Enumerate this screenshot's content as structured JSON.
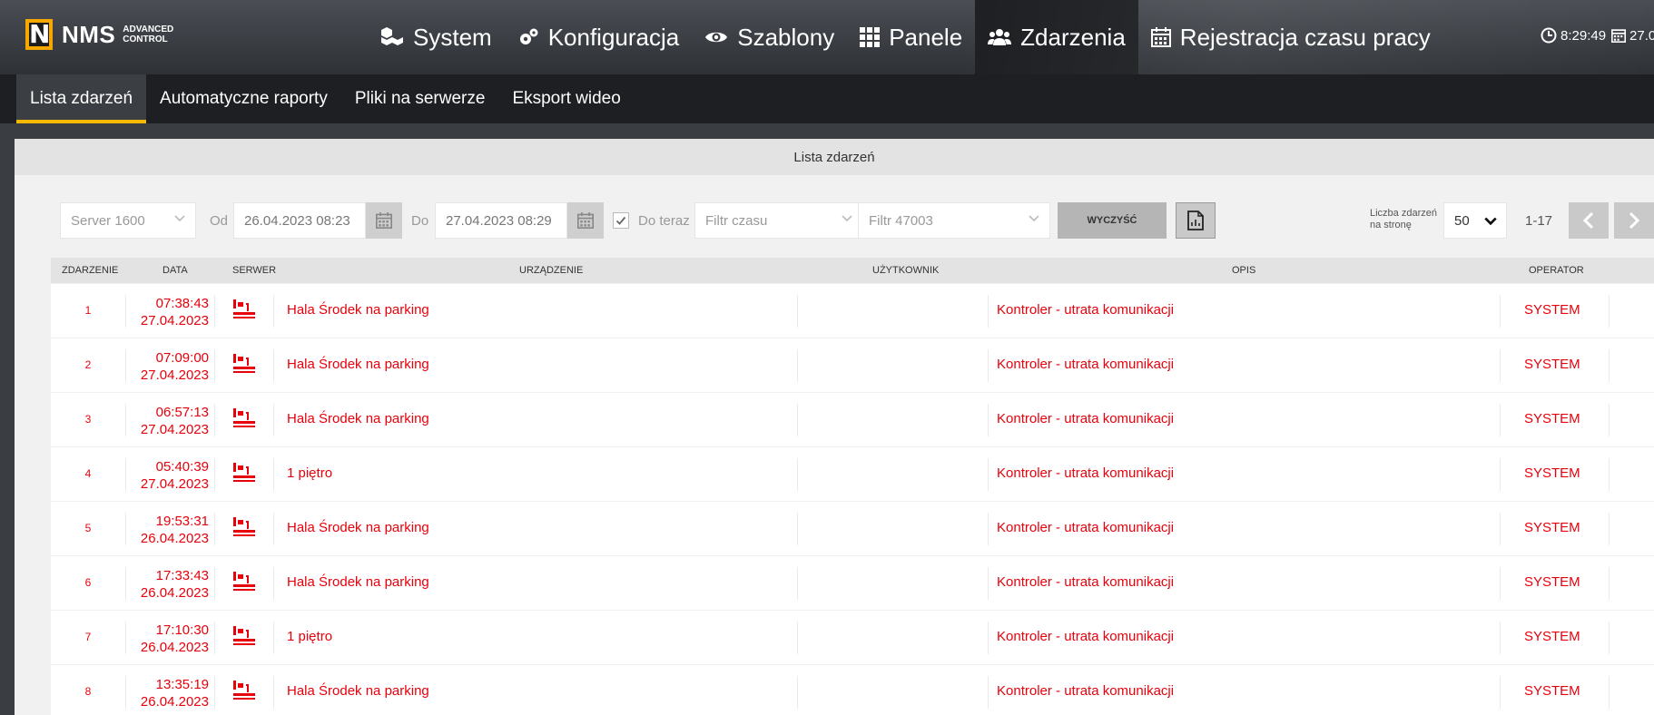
{
  "app": {
    "logo_text": "NMS",
    "logo_sub_1": "ADVANCED",
    "logo_sub_2": "CONTROL"
  },
  "mainnav": [
    {
      "label": "System",
      "icon": "cubes-icon"
    },
    {
      "label": "Konfiguracja",
      "icon": "gears-icon"
    },
    {
      "label": "Szablony",
      "icon": "eye-icon"
    },
    {
      "label": "Panele",
      "icon": "grid-icon"
    },
    {
      "label": "Zdarzenia",
      "icon": "users-icon",
      "active": true
    },
    {
      "label": "Rejestracja czasu pracy",
      "icon": "calendar-icon"
    }
  ],
  "clock": {
    "time": "8:29:49",
    "date": "27.0"
  },
  "subnav": [
    {
      "label": "Lista zdarzeń",
      "active": true
    },
    {
      "label": "Automatyczne raporty"
    },
    {
      "label": "Pliki na serwerze"
    },
    {
      "label": "Eksport wideo"
    }
  ],
  "panel": {
    "title": "Lista zdarzeń"
  },
  "filters": {
    "server": "Server 1600",
    "from_label": "Od",
    "from_value": "26.04.2023 08:23",
    "to_label": "Do",
    "to_value": "27.04.2023 08:29",
    "until_now_label": "Do teraz",
    "until_now_checked": true,
    "time_filter": "Filtr czasu",
    "event_filter": "Filtr 47003",
    "clear_label": "WYCZYŚĆ",
    "per_page_label_1": "Liczba zdarzeń",
    "per_page_label_2": "na stronę",
    "per_page_value": "50",
    "range": "1-17"
  },
  "table": {
    "headers": {
      "event": "Zdarzenie",
      "date": "Data",
      "server": "Serwer",
      "device": "Urządzenie",
      "user": "Użytkownik",
      "desc": "Opis",
      "operator": "Operator"
    },
    "rows": [
      {
        "num": "1",
        "time": "07:38:43",
        "date": "27.04.2023",
        "device": "Hala Środek na parking",
        "user": "",
        "desc": "Kontroler - utrata komunikacji",
        "operator": "SYSTEM"
      },
      {
        "num": "2",
        "time": "07:09:00",
        "date": "27.04.2023",
        "device": "Hala Środek na parking",
        "user": "",
        "desc": "Kontroler - utrata komunikacji",
        "operator": "SYSTEM"
      },
      {
        "num": "3",
        "time": "06:57:13",
        "date": "27.04.2023",
        "device": "Hala Środek na parking",
        "user": "",
        "desc": "Kontroler - utrata komunikacji",
        "operator": "SYSTEM"
      },
      {
        "num": "4",
        "time": "05:40:39",
        "date": "27.04.2023",
        "device": "1 piętro",
        "user": "",
        "desc": "Kontroler - utrata komunikacji",
        "operator": "SYSTEM"
      },
      {
        "num": "5",
        "time": "19:53:31",
        "date": "26.04.2023",
        "device": "Hala Środek na parking",
        "user": "",
        "desc": "Kontroler - utrata komunikacji",
        "operator": "SYSTEM"
      },
      {
        "num": "6",
        "time": "17:33:43",
        "date": "26.04.2023",
        "device": "Hala Środek na parking",
        "user": "",
        "desc": "Kontroler - utrata komunikacji",
        "operator": "SYSTEM"
      },
      {
        "num": "7",
        "time": "17:10:30",
        "date": "26.04.2023",
        "device": "1 piętro",
        "user": "",
        "desc": "Kontroler - utrata komunikacji",
        "operator": "SYSTEM"
      },
      {
        "num": "8",
        "time": "13:35:19",
        "date": "26.04.2023",
        "device": "Hala Środek na parking",
        "user": "",
        "desc": "Kontroler - utrata komunikacji",
        "operator": "SYSTEM"
      }
    ]
  },
  "colors": {
    "accent": "#f6b800",
    "alarm": "#e8000b",
    "nav_bg": "#1d1f22"
  }
}
